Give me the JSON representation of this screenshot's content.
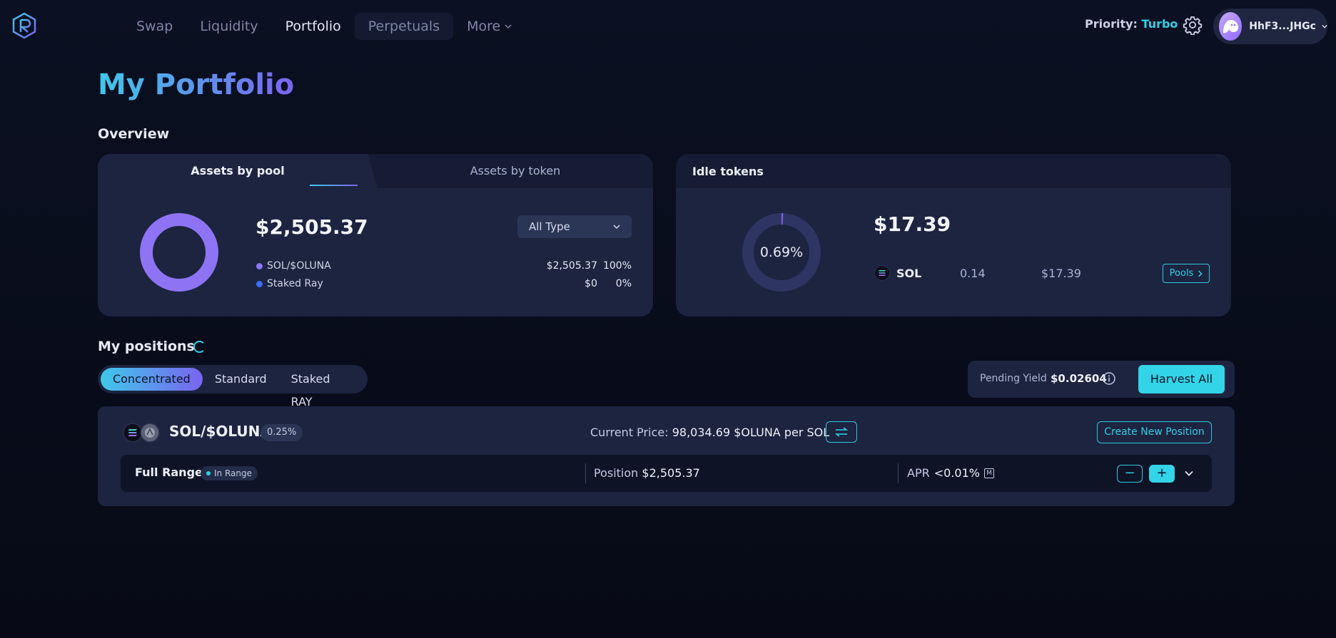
{
  "nav": {
    "items": [
      {
        "label": "Swap",
        "active": false
      },
      {
        "label": "Liquidity",
        "active": false
      },
      {
        "label": "Portfolio",
        "active": true
      },
      {
        "label": "Perpetuals",
        "active": false
      },
      {
        "label": "More",
        "active": false
      }
    ],
    "priority_label": "Priority:",
    "priority_value": "Turbo",
    "wallet_address": "HhF3...JHGc"
  },
  "page": {
    "title": "My Portfolio",
    "overview_title": "Overview",
    "positions_title": "My positions"
  },
  "overview": {
    "tabs": [
      "Assets by pool",
      "Assets by token"
    ],
    "total": "$2,505.37",
    "filter": "All Type",
    "rows": [
      {
        "name": "SOL/$OLUNA",
        "value": "$2,505.37",
        "percent": "100%",
        "color": "#8f73f5"
      },
      {
        "name": "Staked Ray",
        "value": "$0",
        "percent": "0%",
        "color": "#3b6ef5"
      }
    ]
  },
  "idle": {
    "title": "Idle tokens",
    "total": "$17.39",
    "percent_label": "0.69%",
    "percent_value": 0.69,
    "token": {
      "symbol": "SOL",
      "amount": "0.14",
      "value": "$17.39"
    },
    "pools_label": "Pools"
  },
  "positions": {
    "tabs": [
      {
        "label": "Concentrated",
        "active": true
      },
      {
        "label": "Standard",
        "active": false
      },
      {
        "label": "Staked RAY",
        "active": false
      }
    ],
    "pending_label": "Pending Yield",
    "pending_value": "$0.02604",
    "harvest_label": "Harvest All",
    "pool": {
      "name": "SOL/$OLUNA",
      "fee": "0.25%",
      "price_label": "Current Price:",
      "price_value": "98,034.69",
      "price_unit": "$OLUNA per SOL",
      "create_label": "Create New Position"
    },
    "row": {
      "range": "Full Range",
      "status": "In Range",
      "position_label": "Position",
      "position_value": "$2,505.37",
      "apr_label": "APR",
      "apr_value": "<0.01%",
      "m_label": "M"
    }
  },
  "colors": {
    "accent_cyan": "#33d4e8",
    "accent_purple": "#7a64ef",
    "card_bg": "#1c2440"
  }
}
